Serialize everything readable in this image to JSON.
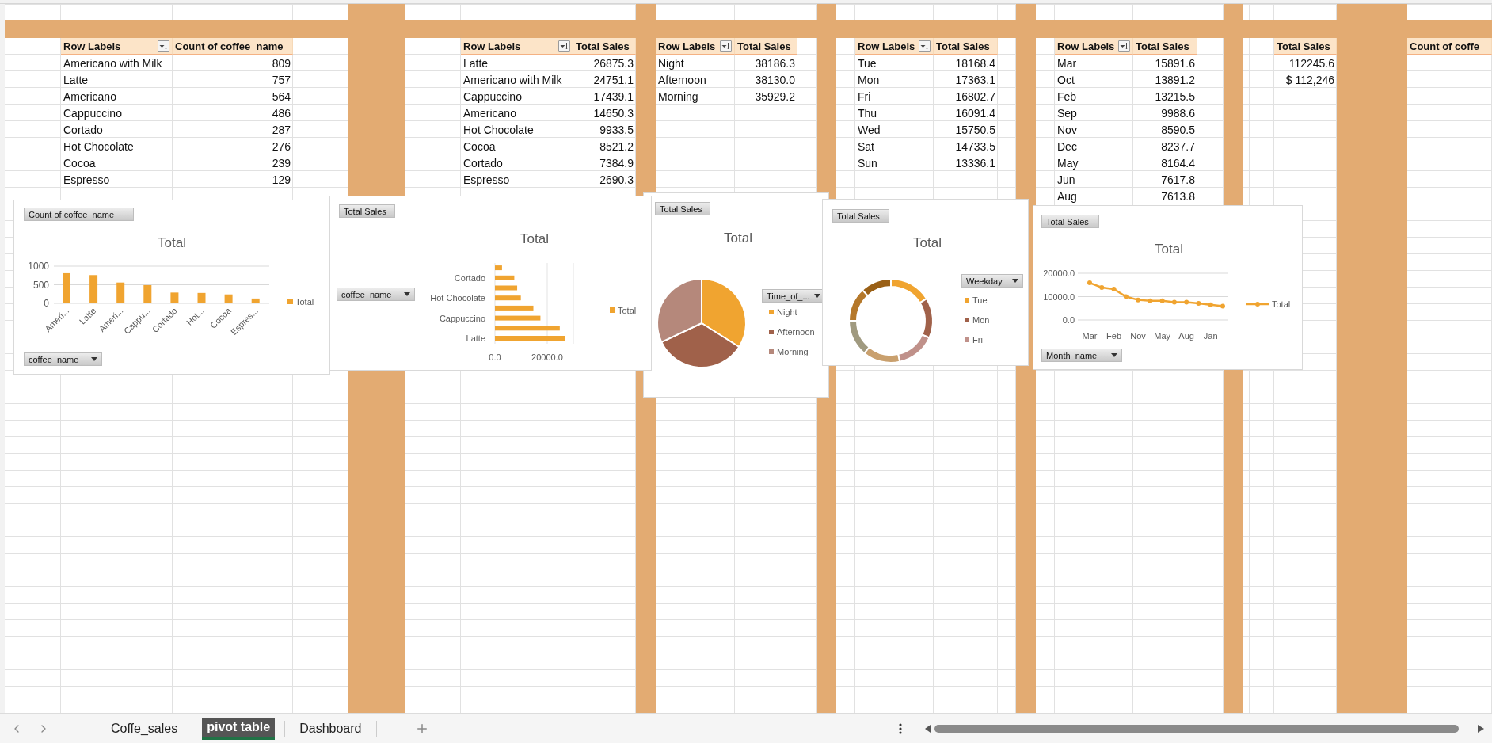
{
  "pivot_tables": [
    {
      "columns": [
        "Row Labels",
        "Count of coffee_name"
      ],
      "rows": [
        [
          "Americano with Milk",
          "809"
        ],
        [
          "Latte",
          "757"
        ],
        [
          "Americano",
          "564"
        ],
        [
          "Cappuccino",
          "486"
        ],
        [
          "Cortado",
          "287"
        ],
        [
          "Hot Chocolate",
          "276"
        ],
        [
          "Cocoa",
          "239"
        ],
        [
          "Espresso",
          "129"
        ]
      ]
    },
    {
      "columns": [
        "Row Labels",
        "Total Sales"
      ],
      "rows": [
        [
          "Latte",
          "26875.3"
        ],
        [
          "Americano with Milk",
          "24751.1"
        ],
        [
          "Cappuccino",
          "17439.1"
        ],
        [
          "Americano",
          "14650.3"
        ],
        [
          "Hot Chocolate",
          "9933.5"
        ],
        [
          "Cocoa",
          "8521.2"
        ],
        [
          "Cortado",
          "7384.9"
        ],
        [
          "Espresso",
          "2690.3"
        ]
      ]
    },
    {
      "columns": [
        "Row Labels",
        "Total Sales"
      ],
      "rows": [
        [
          "Night",
          "38186.3"
        ],
        [
          "Afternoon",
          "38130.0"
        ],
        [
          "Morning",
          "35929.2"
        ]
      ]
    },
    {
      "columns": [
        "Row Labels",
        "Total Sales"
      ],
      "rows": [
        [
          "Tue",
          "18168.4"
        ],
        [
          "Mon",
          "17363.1"
        ],
        [
          "Fri",
          "16802.7"
        ],
        [
          "Thu",
          "16091.4"
        ],
        [
          "Wed",
          "15750.5"
        ],
        [
          "Sat",
          "14733.5"
        ],
        [
          "Sun",
          "13336.1"
        ]
      ]
    },
    {
      "columns": [
        "Row Labels",
        "Total Sales"
      ],
      "rows": [
        [
          "Mar",
          "15891.6"
        ],
        [
          "Oct",
          "13891.2"
        ],
        [
          "Feb",
          "13215.5"
        ],
        [
          "Sep",
          "9988.6"
        ],
        [
          "Nov",
          "8590.5"
        ],
        [
          "Dec",
          "8237.7"
        ],
        [
          "May",
          "8164.4"
        ],
        [
          "Jun",
          "7617.8"
        ],
        [
          "Aug",
          "7613.8"
        ]
      ]
    }
  ],
  "summary": {
    "header": "Total Sales",
    "values": [
      "112245.6",
      "$ 112,246"
    ]
  },
  "partial_pivot": {
    "header": "Count of coffe"
  },
  "charts": [
    {
      "value_field": "Count of coffee_name",
      "axis_field": "coffee_name",
      "chart_data": {
        "type": "bar",
        "title": "Total",
        "categories": [
          "Ameri...",
          "Latte",
          "Ameri...",
          "Cappu...",
          "Cortado",
          "Hot...",
          "Cocoa",
          "Espres..."
        ],
        "series": [
          {
            "name": "Total",
            "color": "#f0a430",
            "values": [
              810,
              760,
              560,
              490,
              290,
              280,
              240,
              130
            ]
          }
        ],
        "ylim": [
          0,
          1000
        ],
        "yticks": [
          0,
          500,
          1000
        ]
      }
    },
    {
      "value_field": "Total Sales",
      "axis_field": "coffee_name",
      "chart_data": {
        "type": "bar",
        "orientation": "horizontal",
        "title": "Total",
        "categories": [
          null,
          "Cortado",
          null,
          "Hot Chocolate",
          null,
          "Cappuccino",
          null,
          "Latte"
        ],
        "series": [
          {
            "name": "Total",
            "color": "#f0a430",
            "values": [
              2700,
              7400,
              8500,
              9900,
              14700,
              17400,
              24800,
              26900
            ]
          }
        ],
        "xlim": [
          0,
          30000
        ],
        "xticks": [
          {
            "value": 0,
            "label": "0.0"
          },
          {
            "value": 20000,
            "label": "20000.0"
          }
        ]
      }
    },
    {
      "value_field": "Total Sales",
      "legend_field": "Time_of_...",
      "chart_data": {
        "type": "pie",
        "title": "Total",
        "categories": [
          "Night",
          "Afternoon",
          "Morning"
        ],
        "colors": [
          "#f0a430",
          "#a0614a",
          "#b5887b"
        ],
        "legend": "right",
        "series": [
          {
            "values": [
              34.0,
              34.0,
              32.0
            ]
          }
        ]
      }
    },
    {
      "value_field": "Total Sales",
      "legend_field": "Weekday",
      "chart_data": {
        "type": "donut",
        "title": "Total",
        "categories": [
          "Tue",
          "Mon",
          "Fri",
          null,
          null,
          null,
          null
        ],
        "colors": [
          "#f0a430",
          "#a0614a",
          "#c0918a",
          "#c9a06e",
          "#a09a80",
          "#b5782a",
          "#9a6016"
        ],
        "legend": "right",
        "values": [
          16.19,
          15.47,
          14.97,
          14.34,
          14.03,
          13.13,
          11.87
        ]
      }
    },
    {
      "value_field": "Total Sales",
      "axis_field": "Month_name",
      "chart_data": {
        "type": "line",
        "title": "Total",
        "categories": [
          "Mar",
          null,
          "Feb",
          null,
          "Nov",
          null,
          "May",
          null,
          "Aug",
          null,
          "Jan",
          null
        ],
        "series": [
          {
            "name": "Total",
            "color": "#f0a430",
            "marker": "circle",
            "values": [
              15900,
              13900,
              13200,
              10000,
              8600,
              8200,
              8200,
              7600,
              7600,
              7100,
              6500,
              5900
            ]
          }
        ],
        "ylim": [
          0,
          20000
        ],
        "yticks": [
          {
            "value": 0,
            "label": "0.0"
          },
          {
            "value": 10000,
            "label": "10000.0"
          },
          {
            "value": 20000,
            "label": "20000.0"
          }
        ]
      }
    }
  ],
  "sheet_tabs": [
    {
      "label": "Coffe_sales",
      "selected": false
    },
    {
      "label": "pivot table",
      "selected": true
    },
    {
      "label": "Dashboard",
      "selected": false
    }
  ]
}
